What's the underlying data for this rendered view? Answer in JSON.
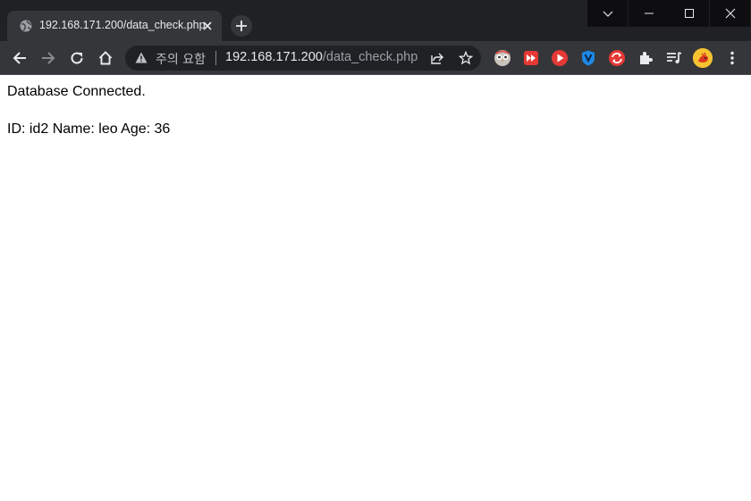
{
  "browser": {
    "tab": {
      "title": "192.168.171.200/data_check.php"
    },
    "omnibox": {
      "security_label": "주의 요함",
      "url_host": "192.168.171.200",
      "url_path": "/data_check.php"
    },
    "icons": [
      "globe-icon",
      "close-icon",
      "plus-icon",
      "chevron-down-icon",
      "minimize-icon",
      "maximize-icon",
      "window-close-icon",
      "back-icon",
      "forward-icon",
      "reload-icon",
      "home-icon",
      "warning-icon",
      "share-icon",
      "star-icon",
      "extensions-icon",
      "reading-list-icon"
    ]
  },
  "page": {
    "status_text": "Database Connected.",
    "record_text": "ID: id2 Name: leo Age: 36"
  }
}
